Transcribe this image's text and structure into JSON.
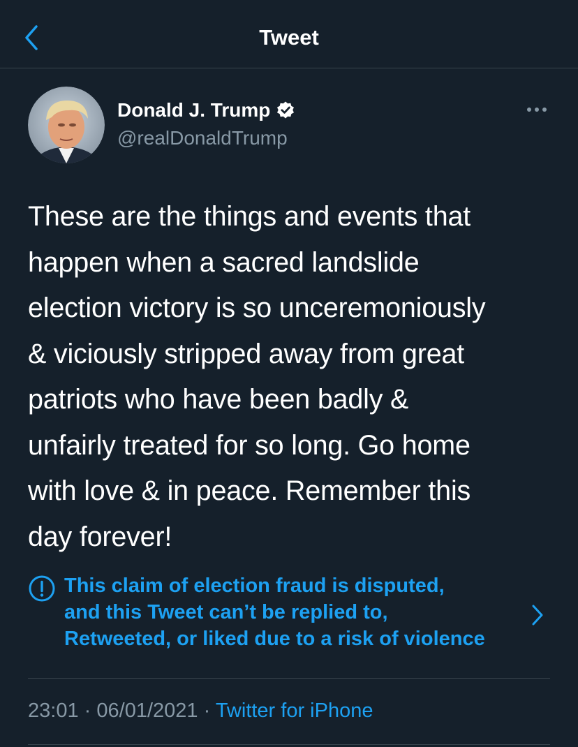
{
  "header": {
    "title": "Tweet",
    "back_icon": "chevron-left-icon"
  },
  "author": {
    "display_name": "Donald J. Trump",
    "handle": "@realDonaldTrump",
    "verified_icon": "verified-badge-icon",
    "more_icon": "more-horizontal-icon"
  },
  "tweet": {
    "text": "These are the things and events that\nhappen when a sacred landslide\nelection victory is so unceremoniously\n& viciously stripped away from great\npatriots who have been badly &\nunfairly treated for so long. Go home\nwith love & in peace. Remember this\nday forever!"
  },
  "notice": {
    "icon": "alert-circle-icon",
    "text": "This claim of election fraud is disputed,\nand this Tweet can’t be replied to,\nRetweeted, or liked due to a risk of violence",
    "chevron_icon": "chevron-right-icon"
  },
  "meta": {
    "time": "23:01",
    "separator": "·",
    "date": "06/01/2021",
    "source": "Twitter for iPhone"
  },
  "colors": {
    "background": "#15202b",
    "accent": "#1da1f2",
    "secondary_text": "#8899a6",
    "divider": "#38444d"
  }
}
